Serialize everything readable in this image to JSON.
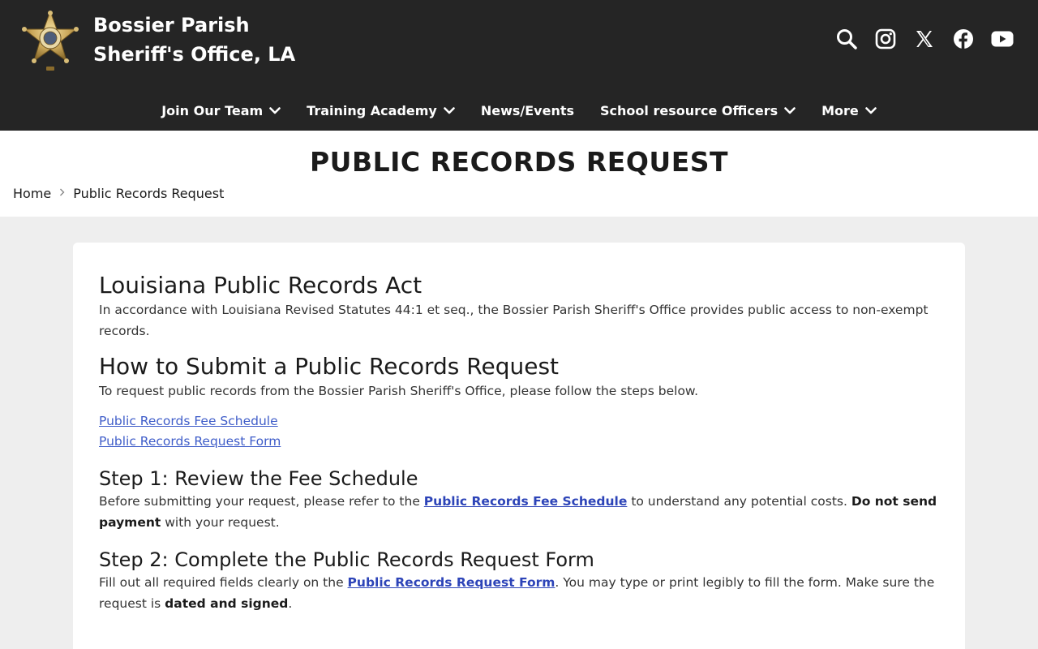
{
  "header": {
    "title_line1": "Bossier Parish",
    "title_line2": "Sheriff's Office, LA",
    "icons": [
      "search-icon",
      "instagram-icon",
      "x-icon",
      "facebook-icon",
      "youtube-icon"
    ]
  },
  "nav": {
    "items": [
      {
        "label": "Join Our Team",
        "has_dropdown": true
      },
      {
        "label": "Training Academy",
        "has_dropdown": true
      },
      {
        "label": "News/Events",
        "has_dropdown": false
      },
      {
        "label": "School resource Officers",
        "has_dropdown": true
      },
      {
        "label": "More",
        "has_dropdown": true
      }
    ]
  },
  "page": {
    "title": "PUBLIC RECORDS REQUEST",
    "breadcrumb": {
      "home": "Home",
      "current": "Public Records Request"
    }
  },
  "content": {
    "h_act": "Louisiana Public Records Act",
    "p_act": "In accordance with Louisiana Revised Statutes 44:1 et seq., the Bossier Parish Sheriff's Office provides public access to non-exempt records.",
    "h_submit": "How to Submit a Public Records Request",
    "p_submit": "To request public records from the Bossier Parish Sheriff's Office, please follow the steps below.",
    "links": [
      "Public Records Fee Schedule",
      "Public Records Request Form"
    ],
    "step1": {
      "heading": "Step 1: Review the Fee Schedule",
      "pre": "Before submitting your request, please refer to the ",
      "link": "Public Records Fee Schedule",
      "mid": " to understand any potential costs. ",
      "bold": "Do not send payment",
      "post": " with your request."
    },
    "step2": {
      "heading": "Step 2: Complete the Public Records Request Form",
      "pre": "Fill out all required fields clearly on the ",
      "link": "Public Records Request Form",
      "mid": ". You may type or print legibly to fill the form. Make sure the request is ",
      "bold": "dated and signed",
      "post": "."
    }
  },
  "colors": {
    "header_bg": "#252525",
    "link": "#3f5dc9",
    "body_bg": "#eeeeee"
  }
}
